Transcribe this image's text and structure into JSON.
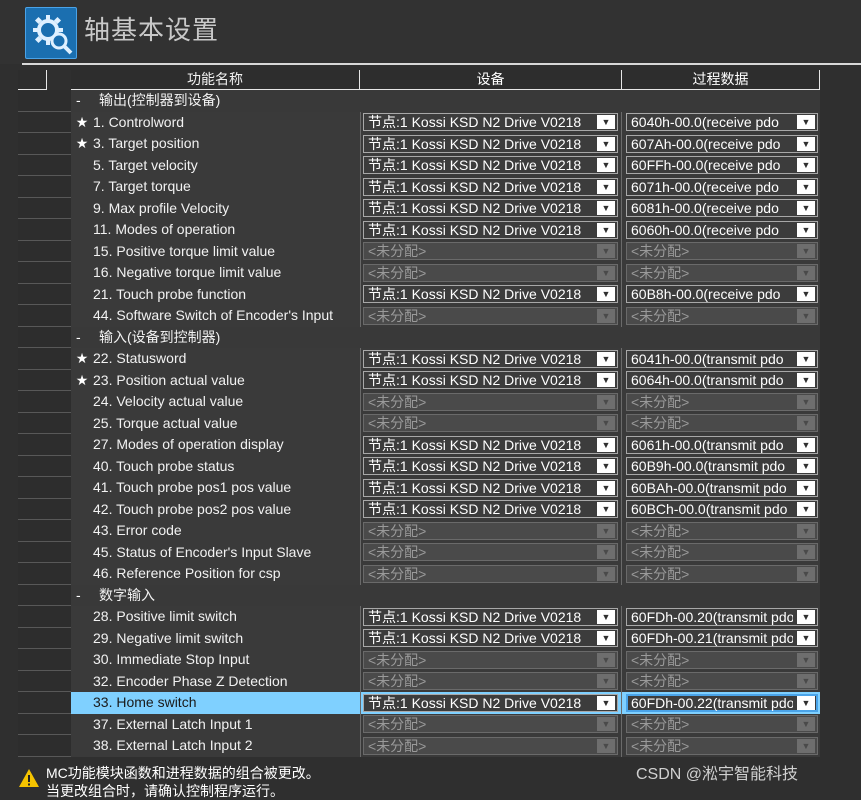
{
  "header": {
    "title": "轴基本设置",
    "icon": "gear-magnifier-icon"
  },
  "table": {
    "columns": {
      "name": "功能名称",
      "device": "设备",
      "process_data": "过程数据"
    },
    "rows": [
      {
        "type": "group",
        "label": "输出(控制器到设备)"
      },
      {
        "type": "data",
        "star": "★",
        "name": "1. Controlword",
        "device": "节点:1 Kossi KSD N2 Drive V0218",
        "pd": "6040h-00.0(receive pdo",
        "assigned": true
      },
      {
        "type": "data",
        "star": "★",
        "name": "3. Target position",
        "device": "节点:1 Kossi KSD N2 Drive V0218",
        "pd": "607Ah-00.0(receive pdo",
        "assigned": true
      },
      {
        "type": "data",
        "star": "",
        "name": "5. Target velocity",
        "device": "节点:1 Kossi KSD N2 Drive V0218",
        "pd": "60FFh-00.0(receive pdo",
        "assigned": true
      },
      {
        "type": "data",
        "star": "",
        "name": "7. Target torque",
        "device": "节点:1 Kossi KSD N2 Drive V0218",
        "pd": "6071h-00.0(receive pdo",
        "assigned": true
      },
      {
        "type": "data",
        "star": "",
        "name": "9. Max profile Velocity",
        "device": "节点:1 Kossi KSD N2 Drive V0218",
        "pd": "6081h-00.0(receive pdo",
        "assigned": true
      },
      {
        "type": "data",
        "star": "",
        "name": "11. Modes of operation",
        "device": "节点:1 Kossi KSD N2 Drive V0218",
        "pd": "6060h-00.0(receive pdo",
        "assigned": true
      },
      {
        "type": "data",
        "star": "",
        "name": "15. Positive torque limit value",
        "device": "<未分配>",
        "pd": "<未分配>",
        "assigned": false
      },
      {
        "type": "data",
        "star": "",
        "name": "16. Negative torque limit value",
        "device": "<未分配>",
        "pd": "<未分配>",
        "assigned": false
      },
      {
        "type": "data",
        "star": "",
        "name": "21. Touch probe function",
        "device": "节点:1 Kossi KSD N2 Drive V0218",
        "pd": "60B8h-00.0(receive pdo",
        "assigned": true
      },
      {
        "type": "data",
        "star": "",
        "name": "44. Software Switch of Encoder's Input",
        "device": "<未分配>",
        "pd": "<未分配>",
        "assigned": false
      },
      {
        "type": "group",
        "label": "输入(设备到控制器)"
      },
      {
        "type": "data",
        "star": "★",
        "name": "22. Statusword",
        "device": "节点:1 Kossi KSD N2 Drive V0218",
        "pd": "6041h-00.0(transmit pdo",
        "assigned": true
      },
      {
        "type": "data",
        "star": "★",
        "name": "23. Position actual value",
        "device": "节点:1 Kossi KSD N2 Drive V0218",
        "pd": "6064h-00.0(transmit pdo",
        "assigned": true
      },
      {
        "type": "data",
        "star": "",
        "name": "24. Velocity actual value",
        "device": "<未分配>",
        "pd": "<未分配>",
        "assigned": false
      },
      {
        "type": "data",
        "star": "",
        "name": "25. Torque actual value",
        "device": "<未分配>",
        "pd": "<未分配>",
        "assigned": false
      },
      {
        "type": "data",
        "star": "",
        "name": "27. Modes of operation display",
        "device": "节点:1 Kossi KSD N2 Drive V0218",
        "pd": "6061h-00.0(transmit pdo",
        "assigned": true
      },
      {
        "type": "data",
        "star": "",
        "name": "40. Touch probe status",
        "device": "节点:1 Kossi KSD N2 Drive V0218",
        "pd": "60B9h-00.0(transmit pdo",
        "assigned": true
      },
      {
        "type": "data",
        "star": "",
        "name": "41. Touch probe pos1 pos value",
        "device": "节点:1 Kossi KSD N2 Drive V0218",
        "pd": "60BAh-00.0(transmit pdo",
        "assigned": true
      },
      {
        "type": "data",
        "star": "",
        "name": "42. Touch probe pos2 pos value",
        "device": "节点:1 Kossi KSD N2 Drive V0218",
        "pd": "60BCh-00.0(transmit pdo",
        "assigned": true
      },
      {
        "type": "data",
        "star": "",
        "name": "43. Error code",
        "device": "<未分配>",
        "pd": "<未分配>",
        "assigned": false
      },
      {
        "type": "data",
        "star": "",
        "name": "45. Status of Encoder's Input Slave",
        "device": "<未分配>",
        "pd": "<未分配>",
        "assigned": false
      },
      {
        "type": "data",
        "star": "",
        "name": "46. Reference Position for csp",
        "device": "<未分配>",
        "pd": "<未分配>",
        "assigned": false
      },
      {
        "type": "group",
        "label": "数字输入"
      },
      {
        "type": "data",
        "star": "",
        "name": "28. Positive limit switch",
        "device": "节点:1 Kossi KSD N2 Drive V0218",
        "pd": "60FDh-00.20(transmit pdo",
        "assigned": true
      },
      {
        "type": "data",
        "star": "",
        "name": "29. Negative limit switch",
        "device": "节点:1 Kossi KSD N2 Drive V0218",
        "pd": "60FDh-00.21(transmit pdo",
        "assigned": true
      },
      {
        "type": "data",
        "star": "",
        "name": "30. Immediate Stop Input",
        "device": "<未分配>",
        "pd": "<未分配>",
        "assigned": false
      },
      {
        "type": "data",
        "star": "",
        "name": "32. Encoder Phase Z Detection",
        "device": "<未分配>",
        "pd": "<未分配>",
        "assigned": false
      },
      {
        "type": "data",
        "star": "",
        "name": "33. Home switch",
        "device": "节点:1 Kossi KSD N2 Drive V0218",
        "pd": "60FDh-00.22(transmit pdo",
        "assigned": true,
        "selected": true
      },
      {
        "type": "data",
        "star": "",
        "name": "37. External Latch Input 1",
        "device": "<未分配>",
        "pd": "<未分配>",
        "assigned": false
      },
      {
        "type": "data",
        "star": "",
        "name": "38. External Latch Input 2",
        "device": "<未分配>",
        "pd": "<未分配>",
        "assigned": false
      }
    ]
  },
  "footer": {
    "warning_icon": "warning-icon",
    "line1": "MC功能模块函数和进程数据的组合被更改。",
    "line2": "当更改组合时，请确认控制程序运行。"
  },
  "watermark": "CSDN @淞宇智能科技",
  "colors": {
    "selected_row": "#7fd0ff",
    "header_icon_bg": "#1b6fb0",
    "background": "#2f2f2f"
  }
}
